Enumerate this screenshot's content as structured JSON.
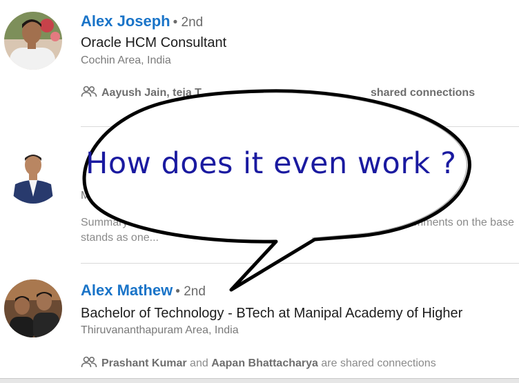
{
  "results": [
    {
      "name": "Alex Joseph",
      "degree": "• 2nd",
      "headline": "Oracle HCM Consultant",
      "location": "Cochin Area, India",
      "shared_prefix": "Aayush Jain, teja T",
      "shared_suffix": "shared connections"
    },
    {
      "headline_partial": "Mi",
      "summary_line1_start": "Summary:",
      "summary_line1_end": "mments on the base",
      "summary_line2": "stands as one..."
    },
    {
      "name": "Alex Mathew",
      "degree": "• 2nd",
      "headline": "Bachelor of Technology - BTech at Manipal Academy of Higher",
      "location": "Thiruvananthapuram Area, India",
      "shared_name1": "Prashant Kumar",
      "shared_and": "and",
      "shared_name2": "Aapan Bhattacharya",
      "shared_suffix": "are shared connections"
    }
  ],
  "speech_bubble": {
    "text": "How does it even work ?"
  },
  "icons": {
    "connections": "people-icon"
  }
}
